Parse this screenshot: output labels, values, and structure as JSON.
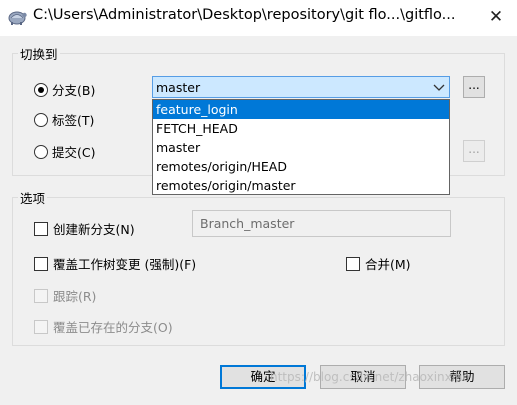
{
  "window": {
    "title": "C:\\Users\\Administrator\\Desktop\\repository\\git flo...\\gitflo...",
    "close_glyph": "✕"
  },
  "switch_group": {
    "legend": "切换到",
    "radio_branch": "分支(B)",
    "radio_tag": "标签(T)",
    "radio_commit": "提交(C)",
    "branch_combo": {
      "value": "master",
      "options": [
        "feature_login",
        "FETCH_HEAD",
        "master",
        "remotes/origin/HEAD",
        "remotes/origin/master"
      ],
      "highlighted": "feature_login"
    },
    "browse_label": "...",
    "commit_browse_label": "..."
  },
  "options_group": {
    "legend": "选项",
    "create_branch": "创建新分支(N)",
    "branch_name_value": "Branch_master",
    "force": "覆盖工作树变更 (强制)(F)",
    "merge": "合并(M)",
    "track": "跟踪(R)",
    "override_existing": "覆盖已存在的分支(O)"
  },
  "buttons": {
    "ok": "确定",
    "cancel": "取消",
    "help": "帮助"
  },
  "watermark": "https://blog.csdn.net/zhaoxinxiao"
}
